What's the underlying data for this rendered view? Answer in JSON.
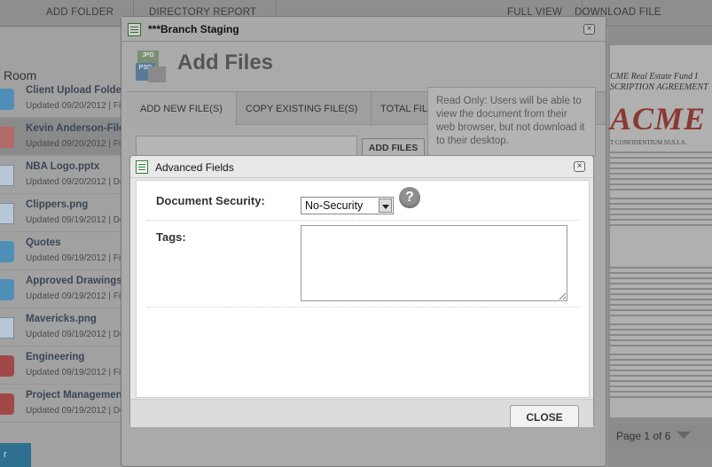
{
  "topbar": {
    "buttons": [
      "ADD FOLDER",
      "DIRECTORY REPORT",
      "FULL VIEW",
      "DOWNLOAD FILE"
    ]
  },
  "sidebar": {
    "room_label": "Room",
    "items": [
      {
        "name": "Client Upload Folder",
        "sub": "Updated 09/20/2012 | Fil",
        "icon": "folder"
      },
      {
        "name": "Kevin Anderson-File",
        "sub": "Updated 09/20/2012 | Fil",
        "icon": "pdf"
      },
      {
        "name": "NBA Logo.pptx",
        "sub": "Updated 09/20/2012 | Do",
        "icon": "doc"
      },
      {
        "name": "Clippers.png",
        "sub": "Updated 09/19/2012 | Do",
        "icon": "doc"
      },
      {
        "name": "Quotes",
        "sub": "Updated 09/19/2012 | Fil",
        "icon": "folder"
      },
      {
        "name": "Approved Drawings",
        "sub": "Updated 09/19/2012 | Fil",
        "icon": "folder"
      },
      {
        "name": "Mavericks.png",
        "sub": "Updated 09/19/2012 | Do",
        "icon": "doc"
      },
      {
        "name": "Engineering",
        "sub": "Updated 09/19/2012 | Fil",
        "icon": "redfolder"
      },
      {
        "name": "Project Management",
        "sub": "Updated 09/19/2012 | Do",
        "icon": "redfolder"
      }
    ],
    "bottom_button": "r"
  },
  "document": {
    "line1": "CME Real Estate Fund I",
    "line2": "SCRIPTION AGREEMENT",
    "logo": "ACME",
    "line3": "T CONFIDENTIUM NULLA.",
    "pager": "Page 1 of 6"
  },
  "branch_modal": {
    "title": "***Branch Staging",
    "heading": "Add Files",
    "icon_labels": [
      "JPG",
      "PSD"
    ],
    "tabs": [
      "ADD NEW FILE(S)",
      "COPY EXISTING FILE(S)",
      "TOTAL FIL"
    ],
    "add_button": "ADD FILES",
    "tooltip": "Read Only: Users will be able to view the document from their web browser, but not download it to their desktop.",
    "close_symbol": "×"
  },
  "advanced_modal": {
    "title": "Advanced Fields",
    "doc_security_label": "Document Security:",
    "doc_security_value": "No-Security",
    "help_symbol": "?",
    "tags_label": "Tags:",
    "tags_value": "",
    "close_button": "CLOSE",
    "close_symbol": "×"
  }
}
